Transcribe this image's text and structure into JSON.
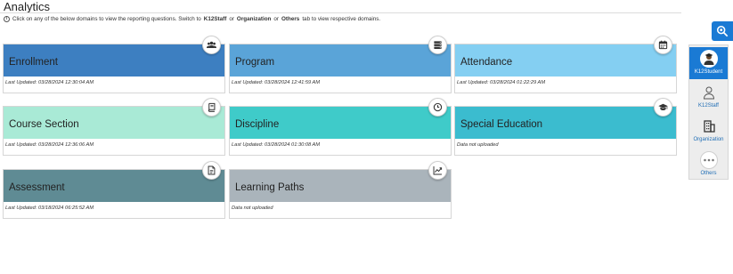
{
  "header": {
    "title": "Analytics",
    "info_pre": "Click on any of the below domains to view the reporting questions. Switch to",
    "info_b1": "K12Staff",
    "info_mid1": "or",
    "info_b2": "Organization",
    "info_mid2": "or",
    "info_b3": "Others",
    "info_post": "tab to view respective domains."
  },
  "cards": [
    {
      "title": "Enrollment",
      "status": "Last Updated: 03/28/2024 12:30:04 AM",
      "color": "#3d7fc1",
      "icon": "users-group-icon"
    },
    {
      "title": "Program",
      "status": "Last Updated: 03/28/2024 12:41:59 AM",
      "color": "#5aa4d8",
      "icon": "server-stack-icon"
    },
    {
      "title": "Attendance",
      "status": "Last Updated: 03/28/2024 01:22:29 AM",
      "color": "#84cff2",
      "icon": "calendar-icon"
    },
    {
      "title": "Course Section",
      "status": "Last Updated: 03/28/2024 12:36:06 AM",
      "color": "#a9ead6",
      "icon": "book-icon"
    },
    {
      "title": "Discipline",
      "status": "Last Updated: 03/28/2024 01:30:08 AM",
      "color": "#3fcbc9",
      "icon": "clock-icon"
    },
    {
      "title": "Special Education",
      "status": "Data not uploaded",
      "color": "#3bbccf",
      "icon": "graduation-cap-icon"
    },
    {
      "title": "Assessment",
      "status": "Last Updated: 03/18/2024 06:25:52 AM",
      "color": "#5f8b94",
      "icon": "document-icon"
    },
    {
      "title": "Learning Paths",
      "status": "Data not uploaded",
      "color": "#aab4bb",
      "icon": "line-chart-icon"
    }
  ],
  "side": {
    "search_icon": "search-icon",
    "tabs": [
      {
        "label": "K12Student",
        "icon": "student-avatar-icon",
        "active": true
      },
      {
        "label": "K12Staff",
        "icon": "staff-person-icon",
        "active": false
      },
      {
        "label": "Organization",
        "icon": "building-icon",
        "active": false
      },
      {
        "label": "Others",
        "icon": "more-dots-icon",
        "active": false
      }
    ]
  }
}
